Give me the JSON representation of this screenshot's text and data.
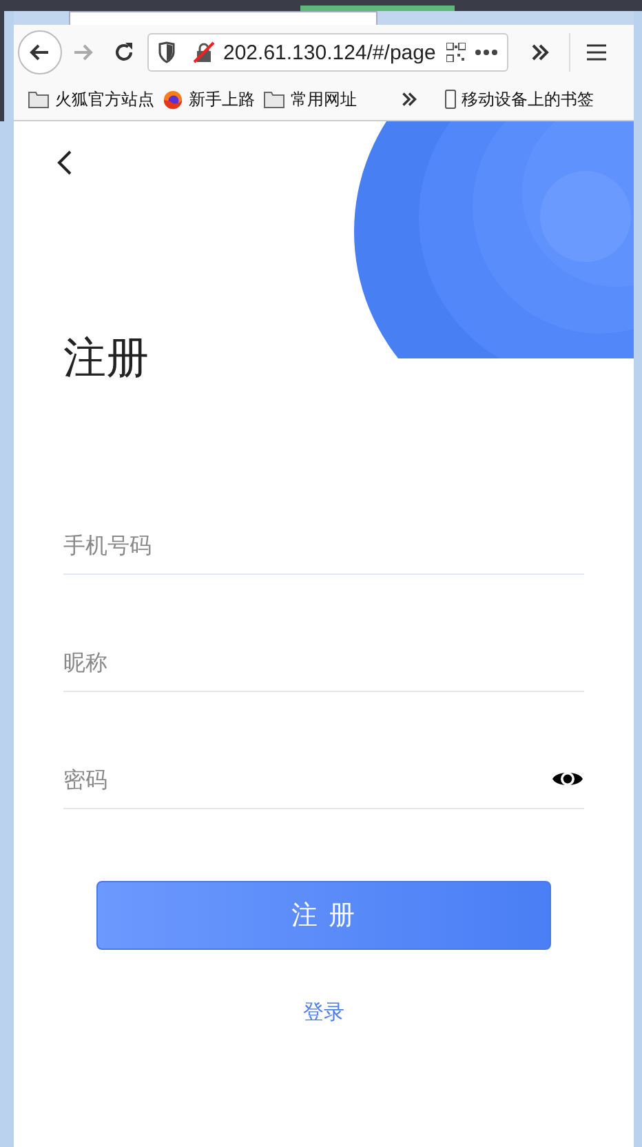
{
  "browser": {
    "url": "202.61.130.124/#/page",
    "bookmarks": [
      {
        "label": "火狐官方站点",
        "kind": "folder"
      },
      {
        "label": "新手上路",
        "kind": "firefox"
      },
      {
        "label": "常用网址",
        "kind": "folder"
      }
    ],
    "mobile_bookmarks": "移动设备上的书签"
  },
  "page": {
    "title": "注册",
    "fields": [
      {
        "placeholder": "手机号码",
        "kind": "text"
      },
      {
        "placeholder": "昵称",
        "kind": "text"
      },
      {
        "placeholder": "密码",
        "kind": "password"
      }
    ],
    "submit": "注 册",
    "login_link": "登录"
  }
}
